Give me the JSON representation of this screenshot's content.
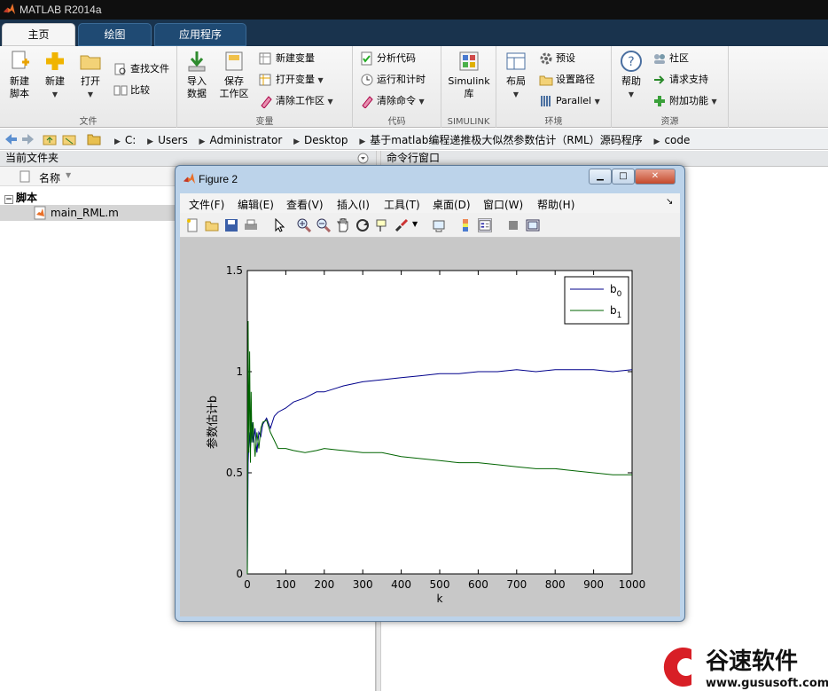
{
  "app": {
    "title": "MATLAB R2014a"
  },
  "tabs": [
    {
      "label": "主页"
    },
    {
      "label": "绘图"
    },
    {
      "label": "应用程序"
    }
  ],
  "ribbon": {
    "file": {
      "caption": "文件",
      "new_script": "新建\n脚本",
      "new": "新建",
      "open": "打开",
      "find_files": "查找文件",
      "compare": "比较"
    },
    "variable": {
      "caption": "变量",
      "import": "导入\n数据",
      "save_ws": "保存\n工作区",
      "new_var": "新建变量",
      "open_var": "打开变量",
      "clear_ws": "清除工作区"
    },
    "code": {
      "caption": "代码",
      "analyze": "分析代码",
      "run_time": "运行和计时",
      "clear_cmd": "清除命令"
    },
    "simulink": {
      "caption": "SIMULINK",
      "lib": "Simulink\n库"
    },
    "env": {
      "caption": "环境",
      "layout": "布局",
      "prefs": "预设",
      "set_path": "设置路径",
      "parallel": "Parallel"
    },
    "resources": {
      "caption": "资源",
      "help": "帮助",
      "community": "社区",
      "support": "请求支持",
      "addons": "附加功能"
    }
  },
  "address": {
    "crumbs": [
      "C:",
      "Users",
      "Administrator",
      "Desktop",
      "基于matlab编程递推极大似然参数估计（RML）源码程序",
      "code"
    ]
  },
  "left_panel": {
    "title": "当前文件夹",
    "col_name": "名称",
    "group": "脚本",
    "file": "main_RML.m"
  },
  "right_panel": {
    "title": "命令行窗口"
  },
  "figure": {
    "title": "Figure 2",
    "menu": [
      "文件(F)",
      "编辑(E)",
      "查看(V)",
      "插入(I)",
      "工具(T)",
      "桌面(D)",
      "窗口(W)",
      "帮助(H)"
    ]
  },
  "chart_data": {
    "type": "line",
    "xlabel": "k",
    "ylabel": "参数估计b",
    "xlim": [
      0,
      1000
    ],
    "ylim": [
      0,
      1.5
    ],
    "xticks": [
      0,
      100,
      200,
      300,
      400,
      500,
      600,
      700,
      800,
      900,
      1000
    ],
    "yticks": [
      0,
      0.5,
      1,
      1.5
    ],
    "legend": "top-right",
    "grid": false,
    "series": [
      {
        "name": "b0",
        "color": "#00008b",
        "x": [
          0,
          2,
          5,
          8,
          12,
          16,
          20,
          25,
          30,
          35,
          40,
          50,
          60,
          70,
          80,
          100,
          120,
          150,
          180,
          200,
          250,
          300,
          350,
          400,
          450,
          500,
          550,
          600,
          650,
          700,
          750,
          800,
          850,
          900,
          950,
          1000
        ],
        "y": [
          0,
          0.55,
          0.7,
          0.62,
          0.75,
          0.65,
          0.72,
          0.6,
          0.7,
          0.68,
          0.74,
          0.77,
          0.72,
          0.78,
          0.8,
          0.82,
          0.85,
          0.87,
          0.9,
          0.9,
          0.93,
          0.95,
          0.96,
          0.97,
          0.98,
          0.99,
          0.99,
          1.0,
          1.0,
          1.01,
          1.0,
          1.01,
          1.01,
          1.01,
          1.0,
          1.01
        ]
      },
      {
        "name": "b1",
        "color": "#006400",
        "x": [
          0,
          2,
          4,
          6,
          8,
          10,
          12,
          15,
          20,
          25,
          30,
          35,
          40,
          50,
          60,
          70,
          80,
          100,
          120,
          150,
          180,
          200,
          250,
          300,
          350,
          400,
          450,
          500,
          550,
          600,
          650,
          700,
          750,
          800,
          850,
          900,
          950,
          1000
        ],
        "y": [
          0,
          1.25,
          0.6,
          1.1,
          0.55,
          0.9,
          0.65,
          0.75,
          0.58,
          0.7,
          0.62,
          0.72,
          0.75,
          0.76,
          0.7,
          0.66,
          0.62,
          0.62,
          0.61,
          0.6,
          0.61,
          0.62,
          0.61,
          0.6,
          0.6,
          0.58,
          0.57,
          0.56,
          0.55,
          0.55,
          0.54,
          0.53,
          0.52,
          0.52,
          0.51,
          0.5,
          0.49,
          0.49
        ]
      }
    ]
  }
}
